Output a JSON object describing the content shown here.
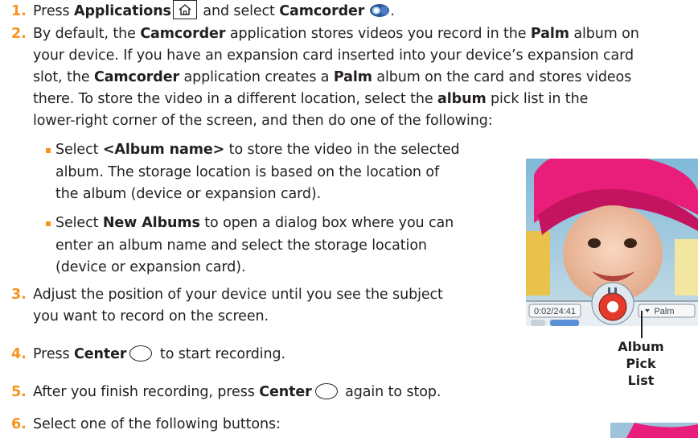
{
  "steps": [
    {
      "num": "1.",
      "pre": "Press ",
      "b1": "Applications",
      "mid": " and select ",
      "b2": "Camcorder",
      "post": "."
    },
    {
      "num": "2.",
      "lines": [
        {
          "pre": "By default, the ",
          "b1": "Camcorder",
          "mid": " application stores videos you record in the ",
          "b2": "Palm",
          "post": " album on"
        },
        {
          "text": "your device. If you have an expansion card inserted into your device’s expansion card"
        },
        {
          "pre": "slot, the ",
          "b1": "Camcorder",
          "mid": " application creates a ",
          "b2": "Palm",
          "post": " album on the card and stores videos"
        },
        {
          "pre": "there. To store the video in a different location, select the ",
          "b1": "album",
          "post": " pick list in the"
        },
        {
          "text": "lower-right corner of the screen, and then do one of the following:"
        }
      ]
    },
    {
      "num": "3.",
      "line1": "Adjust the position of your device until you see the subject",
      "line2": "you want to record on the screen."
    },
    {
      "num": "4.",
      "pre": "Press ",
      "b1": "Center",
      "post": " to start recording."
    },
    {
      "num": "5.",
      "pre": "After you finish recording, press ",
      "b1": "Center",
      "post": " again to stop."
    },
    {
      "num": "6.",
      "text": "Select one of the following buttons:"
    }
  ],
  "bullets": [
    {
      "pre": "Select ",
      "b": "<Album name>",
      "post": " to store the video in the selected",
      "lines": [
        "album. The storage location is based on the location of",
        "the album (device or expansion card)."
      ]
    },
    {
      "pre": "Select ",
      "b": "New Albums",
      "post": " to open a dialog box where you can",
      "lines": [
        "enter an album name and select the storage location",
        "(device or expansion card)."
      ]
    }
  ],
  "screen": {
    "timer": "0:02/24:41",
    "album": "Palm"
  },
  "callout": {
    "line1": "Album",
    "line2": "Pick List"
  },
  "colors": {
    "accent": "#f7941d",
    "text": "#231f20"
  },
  "icons": [
    "home-icon",
    "camcorder-icon",
    "center-button-icon"
  ]
}
